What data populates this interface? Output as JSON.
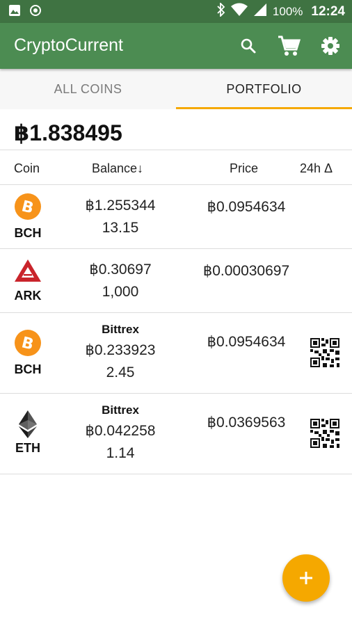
{
  "status": {
    "battery": "100%",
    "time": "12:24"
  },
  "app": {
    "title": "CryptoCurrent"
  },
  "tabs": [
    {
      "label": "ALL COINS",
      "active": false
    },
    {
      "label": "PORTFOLIO",
      "active": true
    }
  ],
  "portfolio_total": "฿1.838495",
  "columns": {
    "coin": "Coin",
    "balance": "Balance↓",
    "price": "Price",
    "change": "24h Δ"
  },
  "holdings": [
    {
      "symbol": "BCH",
      "icon": "bitcoin-cash-icon",
      "exchange": "",
      "btc_balance": "฿1.255344",
      "amount": "13.15",
      "price": "฿0.0954634",
      "qr": false
    },
    {
      "symbol": "ARK",
      "icon": "ark-icon",
      "exchange": "",
      "btc_balance": "฿0.30697",
      "amount": "1,000",
      "price": "฿0.00030697",
      "qr": false
    },
    {
      "symbol": "BCH",
      "icon": "bitcoin-cash-icon",
      "exchange": "Bittrex",
      "btc_balance": "฿0.233923",
      "amount": "2.45",
      "price": "฿0.0954634",
      "qr": true
    },
    {
      "symbol": "ETH",
      "icon": "ethereum-icon",
      "exchange": "Bittrex",
      "btc_balance": "฿0.042258",
      "amount": "1.14",
      "price": "฿0.0369563",
      "qr": true
    }
  ],
  "colors": {
    "status_bar": "#3f7342",
    "app_bar": "#4c8c52",
    "accent": "#f5a800",
    "bitcoin_orange": "#f7931a",
    "ark_red": "#c9242b"
  }
}
